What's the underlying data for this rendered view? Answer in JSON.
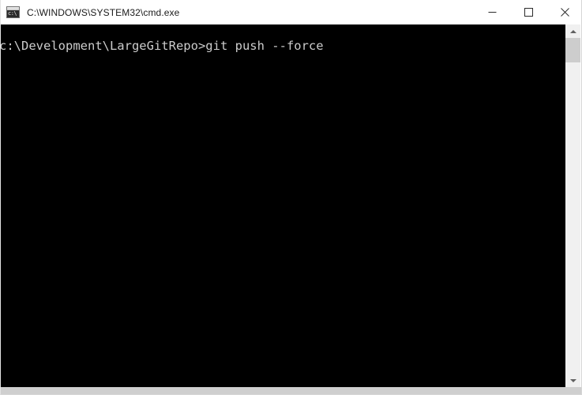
{
  "window": {
    "title": "C:\\WINDOWS\\SYSTEM32\\cmd.exe",
    "icon": "cmd-console-icon",
    "icon_text": "c:\\",
    "background_color": "#000000",
    "titlebar_color": "#ffffff",
    "text_color": "#cccccc"
  },
  "caption_buttons": {
    "minimize": {
      "name": "minimize-button",
      "glyph": "—",
      "tooltip": "Minimize"
    },
    "maximize": {
      "name": "maximize-button",
      "glyph": "□",
      "tooltip": "Maximize"
    },
    "close": {
      "name": "close-button",
      "glyph": "✕",
      "tooltip": "Close"
    }
  },
  "console": {
    "lines": [
      "c:\\Development\\LargeGitRepo>git push --force"
    ],
    "prompt_path": "c:\\Development\\LargeGitRepo",
    "prompt_symbol": ">",
    "command": "git push --force"
  },
  "scrollbar": {
    "up_arrow": "scroll-up-arrow-icon",
    "down_arrow": "scroll-down-arrow-icon",
    "thumb_color": "#cdcdcd",
    "track_color": "#f0f0f0"
  }
}
